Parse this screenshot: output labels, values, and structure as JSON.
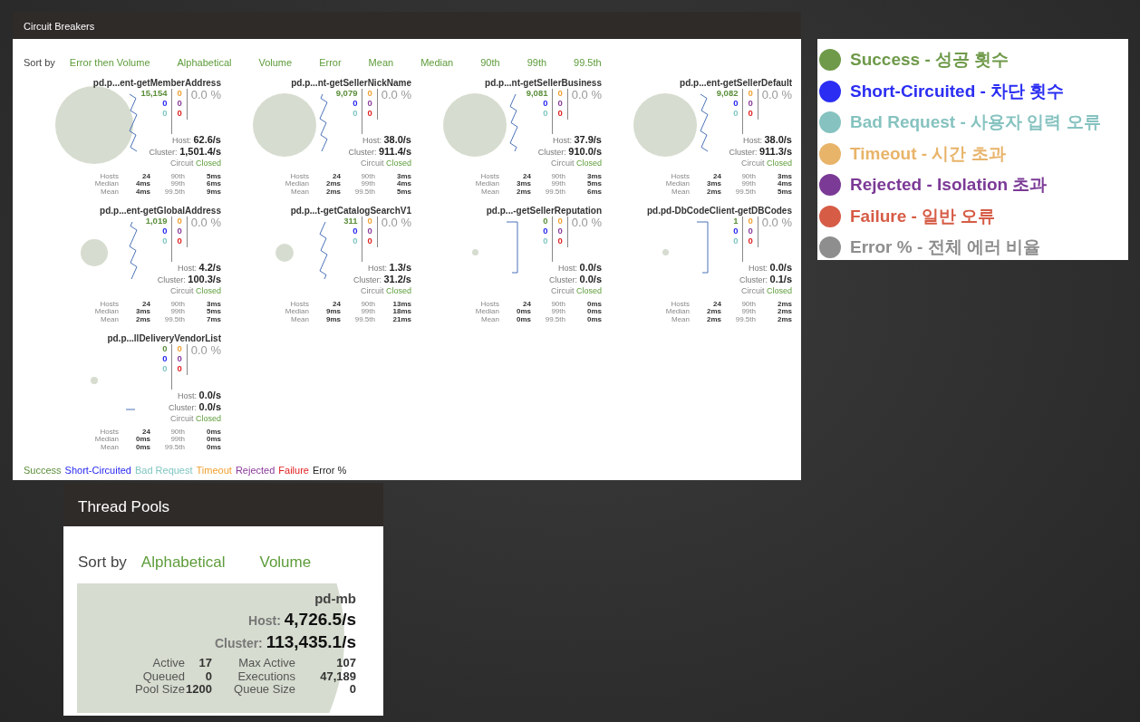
{
  "circuit_breakers": {
    "title": "Circuit Breakers",
    "sort_label": "Sort by",
    "sort_options": [
      "Error then Volume",
      "Alphabetical",
      "Volume",
      "Error",
      "Mean",
      "Median",
      "90th",
      "99th",
      "99.5th"
    ],
    "circuits": [
      {
        "name": "pd.p...ent-getMemberAddress",
        "counts": [
          "15,154",
          "0",
          "0",
          "0",
          "0",
          "0"
        ],
        "error_percent": "0.0 %",
        "host_label": "Host:",
        "host_rate": "62.6/s",
        "cluster_label": "Cluster:",
        "cluster_rate": "1,501.4/s",
        "circuit_label": "Circuit",
        "circuit_status": "Closed",
        "stats": [
          [
            "Hosts",
            "24",
            "90th",
            "5ms"
          ],
          [
            "Median",
            "4ms",
            "99th",
            "6ms"
          ],
          [
            "Mean",
            "4ms",
            "99.5th",
            "9ms"
          ]
        ]
      },
      {
        "name": "pd.p...nt-getSellerNickName",
        "counts": [
          "9,079",
          "0",
          "0",
          "0",
          "0",
          "0"
        ],
        "error_percent": "0.0 %",
        "host_label": "Host:",
        "host_rate": "38.0/s",
        "cluster_label": "Cluster:",
        "cluster_rate": "911.4/s",
        "circuit_label": "Circuit",
        "circuit_status": "Closed",
        "stats": [
          [
            "Hosts",
            "24",
            "90th",
            "3ms"
          ],
          [
            "Median",
            "2ms",
            "99th",
            "4ms"
          ],
          [
            "Mean",
            "2ms",
            "99.5th",
            "5ms"
          ]
        ]
      },
      {
        "name": "pd.p...nt-getSellerBusiness",
        "counts": [
          "9,081",
          "0",
          "0",
          "0",
          "0",
          "0"
        ],
        "error_percent": "0.0 %",
        "host_label": "Host:",
        "host_rate": "37.9/s",
        "cluster_label": "Cluster:",
        "cluster_rate": "910.0/s",
        "circuit_label": "Circuit",
        "circuit_status": "Closed",
        "stats": [
          [
            "Hosts",
            "24",
            "90th",
            "3ms"
          ],
          [
            "Median",
            "3ms",
            "99th",
            "5ms"
          ],
          [
            "Mean",
            "2ms",
            "99.5th",
            "6ms"
          ]
        ]
      },
      {
        "name": "pd.p...ent-getSellerDefault",
        "counts": [
          "9,082",
          "0",
          "0",
          "0",
          "0",
          "0"
        ],
        "error_percent": "0.0 %",
        "host_label": "Host:",
        "host_rate": "38.0/s",
        "cluster_label": "Cluster:",
        "cluster_rate": "911.3/s",
        "circuit_label": "Circuit",
        "circuit_status": "Closed",
        "stats": [
          [
            "Hosts",
            "24",
            "90th",
            "3ms"
          ],
          [
            "Median",
            "3ms",
            "99th",
            "4ms"
          ],
          [
            "Mean",
            "2ms",
            "99.5th",
            "5ms"
          ]
        ]
      },
      {
        "name": "pd.p...ent-getGlobalAddress",
        "counts": [
          "1,019",
          "0",
          "0",
          "0",
          "0",
          "0"
        ],
        "error_percent": "0.0 %",
        "host_label": "Host:",
        "host_rate": "4.2/s",
        "cluster_label": "Cluster:",
        "cluster_rate": "100.3/s",
        "circuit_label": "Circuit",
        "circuit_status": "Closed",
        "stats": [
          [
            "Hosts",
            "24",
            "90th",
            "3ms"
          ],
          [
            "Median",
            "3ms",
            "99th",
            "5ms"
          ],
          [
            "Mean",
            "2ms",
            "99.5th",
            "7ms"
          ]
        ]
      },
      {
        "name": "pd.p...t-getCatalogSearchV1",
        "counts": [
          "311",
          "0",
          "0",
          "0",
          "0",
          "0"
        ],
        "error_percent": "0.0 %",
        "host_label": "Host:",
        "host_rate": "1.3/s",
        "cluster_label": "Cluster:",
        "cluster_rate": "31.2/s",
        "circuit_label": "Circuit",
        "circuit_status": "Closed",
        "stats": [
          [
            "Hosts",
            "24",
            "90th",
            "13ms"
          ],
          [
            "Median",
            "9ms",
            "99th",
            "18ms"
          ],
          [
            "Mean",
            "9ms",
            "99.5th",
            "21ms"
          ]
        ]
      },
      {
        "name": "pd.p...-getSellerReputation",
        "counts": [
          "0",
          "0",
          "0",
          "0",
          "0",
          "0"
        ],
        "error_percent": "0.0 %",
        "host_label": "Host:",
        "host_rate": "0.0/s",
        "cluster_label": "Cluster:",
        "cluster_rate": "0.0/s",
        "circuit_label": "Circuit",
        "circuit_status": "Closed",
        "stats": [
          [
            "Hosts",
            "24",
            "90th",
            "0ms"
          ],
          [
            "Median",
            "0ms",
            "99th",
            "0ms"
          ],
          [
            "Mean",
            "0ms",
            "99.5th",
            "0ms"
          ]
        ]
      },
      {
        "name": "pd.pd-DbCodeClient-getDBCodes",
        "counts": [
          "1",
          "0",
          "0",
          "0",
          "0",
          "0"
        ],
        "error_percent": "0.0 %",
        "host_label": "Host:",
        "host_rate": "0.0/s",
        "cluster_label": "Cluster:",
        "cluster_rate": "0.1/s",
        "circuit_label": "Circuit",
        "circuit_status": "Closed",
        "stats": [
          [
            "Hosts",
            "24",
            "90th",
            "2ms"
          ],
          [
            "Median",
            "2ms",
            "99th",
            "2ms"
          ],
          [
            "Mean",
            "2ms",
            "99.5th",
            "2ms"
          ]
        ]
      },
      {
        "name": "pd.p...llDeliveryVendorList",
        "counts": [
          "0",
          "0",
          "0",
          "0",
          "0",
          "0"
        ],
        "error_percent": "0.0 %",
        "host_label": "Host:",
        "host_rate": "0.0/s",
        "cluster_label": "Cluster:",
        "cluster_rate": "0.0/s",
        "circuit_label": "Circuit",
        "circuit_status": "Closed",
        "stats": [
          [
            "Hosts",
            "24",
            "90th",
            "0ms"
          ],
          [
            "Median",
            "0ms",
            "99th",
            "0ms"
          ],
          [
            "Mean",
            "0ms",
            "99.5th",
            "0ms"
          ]
        ]
      }
    ],
    "legend": [
      {
        "label": "Success",
        "color": "#5b8e3a"
      },
      {
        "label": "Short-Circuited",
        "color": "#2727f0"
      },
      {
        "label": "Bad Request",
        "color": "#7fc6c2"
      },
      {
        "label": "Timeout",
        "color": "#f0a030"
      },
      {
        "label": "Rejected",
        "color": "#8a3a9a"
      },
      {
        "label": "Failure",
        "color": "#e02020"
      },
      {
        "label": "Error %",
        "color": "#222222"
      }
    ]
  },
  "legend_panel": {
    "items": [
      {
        "label": "Success - 성공 횟수",
        "color": "#6f9a4a"
      },
      {
        "label": "Short-Circuited - 차단 횟수",
        "color": "#2b2ef2"
      },
      {
        "label": "Bad Request - 사용자 입력 오류",
        "color": "#86c3c0"
      },
      {
        "label": "Timeout - 시간 초과",
        "color": "#e8b46a"
      },
      {
        "label": "Rejected - Isolation 초과",
        "color": "#7b3a96"
      },
      {
        "label": "Failure - 일반 오류",
        "color": "#d65c46"
      },
      {
        "label": "Error % - 전체 에러 비율",
        "color": "#8e8e8e"
      }
    ]
  },
  "thread_pools": {
    "title": "Thread Pools",
    "sort_label": "Sort by",
    "sort_options": [
      "Alphabetical",
      "Volume"
    ],
    "pools": [
      {
        "name": "pd-mb",
        "host_label": "Host:",
        "host_rate": "4,726.5/s",
        "cluster_label": "Cluster:",
        "cluster_rate": "113,435.1/s",
        "stats": [
          [
            "Active",
            "17",
            "Max Active",
            "107"
          ],
          [
            "Queued",
            "0",
            "Executions",
            "47,189"
          ],
          [
            "Pool Size",
            "1200",
            "Queue Size",
            "0"
          ]
        ]
      }
    ]
  }
}
